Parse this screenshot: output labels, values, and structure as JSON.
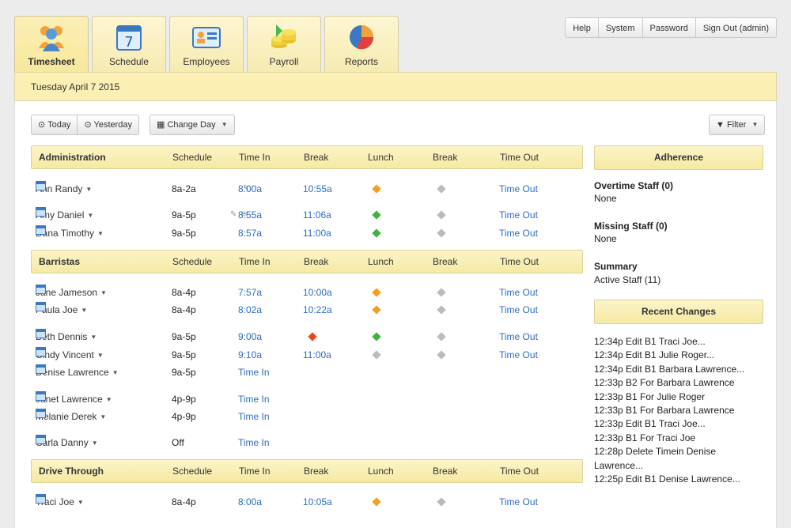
{
  "tabs": [
    {
      "label": "Timesheet",
      "icon": "people-icon",
      "active": true
    },
    {
      "label": "Schedule",
      "icon": "calendar-icon",
      "active": false
    },
    {
      "label": "Employees",
      "icon": "id-card-icon",
      "active": false
    },
    {
      "label": "Payroll",
      "icon": "coins-icon",
      "active": false
    },
    {
      "label": "Reports",
      "icon": "pie-chart-icon",
      "active": false
    }
  ],
  "topnav": [
    "Help",
    "System",
    "Password",
    "Sign Out (admin)"
  ],
  "date": "Tuesday April 7 2015",
  "toolbar": {
    "today": "Today",
    "yesterday": "Yesterday",
    "change_day": "Change Day",
    "filter": "Filter"
  },
  "columns": [
    "Schedule",
    "Time In",
    "Break",
    "Lunch",
    "Break",
    "Time Out"
  ],
  "sections": [
    {
      "name": "Administration",
      "rows": [
        {
          "name": "Ann Randy",
          "schedule": "8a-2a",
          "time_in": "8:00a",
          "break1": "10:55a",
          "lunch": "orange",
          "break2": "gray",
          "time_out": "Time Out",
          "edit": true,
          "note": false
        },
        {
          "name": "Amy Daniel",
          "schedule": "9a-5p",
          "time_in": "8:55a",
          "break1": "11:06a",
          "lunch": "green",
          "break2": "gray",
          "time_out": "Time Out",
          "edit": true,
          "note": true
        },
        {
          "name": "Dana Timothy",
          "schedule": "9a-5p",
          "time_in": "8:57a",
          "break1": "11:00a",
          "lunch": "green",
          "break2": "gray",
          "time_out": "Time Out",
          "edit": false,
          "note": false
        }
      ]
    },
    {
      "name": "Barristas",
      "rows": [
        {
          "name": "Jane Jameson",
          "schedule": "8a-4p",
          "time_in": "7:57a",
          "break1": "10:00a",
          "lunch": "orange",
          "break2": "gray",
          "time_out": "Time Out"
        },
        {
          "name": "Paula Joe",
          "schedule": "8a-4p",
          "time_in": "8:02a",
          "break1": "10:22a",
          "lunch": "orange",
          "break2": "gray",
          "time_out": "Time Out"
        },
        {
          "name": "Beth Dennis",
          "schedule": "9a-5p",
          "time_in": "9:00a",
          "break1": "red",
          "lunch": "green",
          "break2": "gray",
          "time_out": "Time Out"
        },
        {
          "name": "Cindy Vincent",
          "schedule": "9a-5p",
          "time_in": "9:10a",
          "break1": "11:00a",
          "lunch": "gray",
          "break2": "gray",
          "time_out": "Time Out"
        },
        {
          "name": "Denise Lawrence",
          "schedule": "9a-5p",
          "time_in": "Time In"
        },
        {
          "name": "Janet Lawrence",
          "schedule": "4p-9p",
          "time_in": "Time In"
        },
        {
          "name": "Melanie Derek",
          "schedule": "4p-9p",
          "time_in": "Time In"
        },
        {
          "name": "Carla Danny",
          "schedule": "Off",
          "time_in": "Time In"
        }
      ]
    },
    {
      "name": "Drive Through",
      "rows": [
        {
          "name": "Traci Joe",
          "schedule": "8a-4p",
          "time_in": "8:00a",
          "break1": "10:05a",
          "lunch": "orange",
          "break2": "gray",
          "time_out": "Time Out"
        }
      ]
    }
  ],
  "sidebar": {
    "adherence_title": "Adherence",
    "overtime_label": "Overtime Staff (0)",
    "overtime_value": "None",
    "missing_label": "Missing Staff (0)",
    "missing_value": "None",
    "summary_label": "Summary",
    "summary_value": "Active Staff (11)",
    "recent_title": "Recent Changes",
    "changes": [
      "12:34p Edit B1 Traci Joe...",
      "12:34p Edit B1 Julie Roger...",
      "12:34p Edit B1 Barbara Lawrence...",
      "12:33p B2 For Barbara Lawrence",
      "12:33p B1 For Julie Roger",
      "12:33p B1 For Barbara Lawrence",
      "12:33p Edit B1 Traci Joe...",
      "12:33p B1 For Traci Joe",
      "12:28p Delete Timein Denise",
      "Lawrence...",
      "12:25p Edit B1 Denise Lawrence..."
    ]
  },
  "colors": {
    "link": "#2b6cc4",
    "orange": "#f0a020",
    "green": "#3fb33f",
    "gray": "#bbbbbb",
    "red": "#e8461c",
    "header": "#fbefb4"
  }
}
